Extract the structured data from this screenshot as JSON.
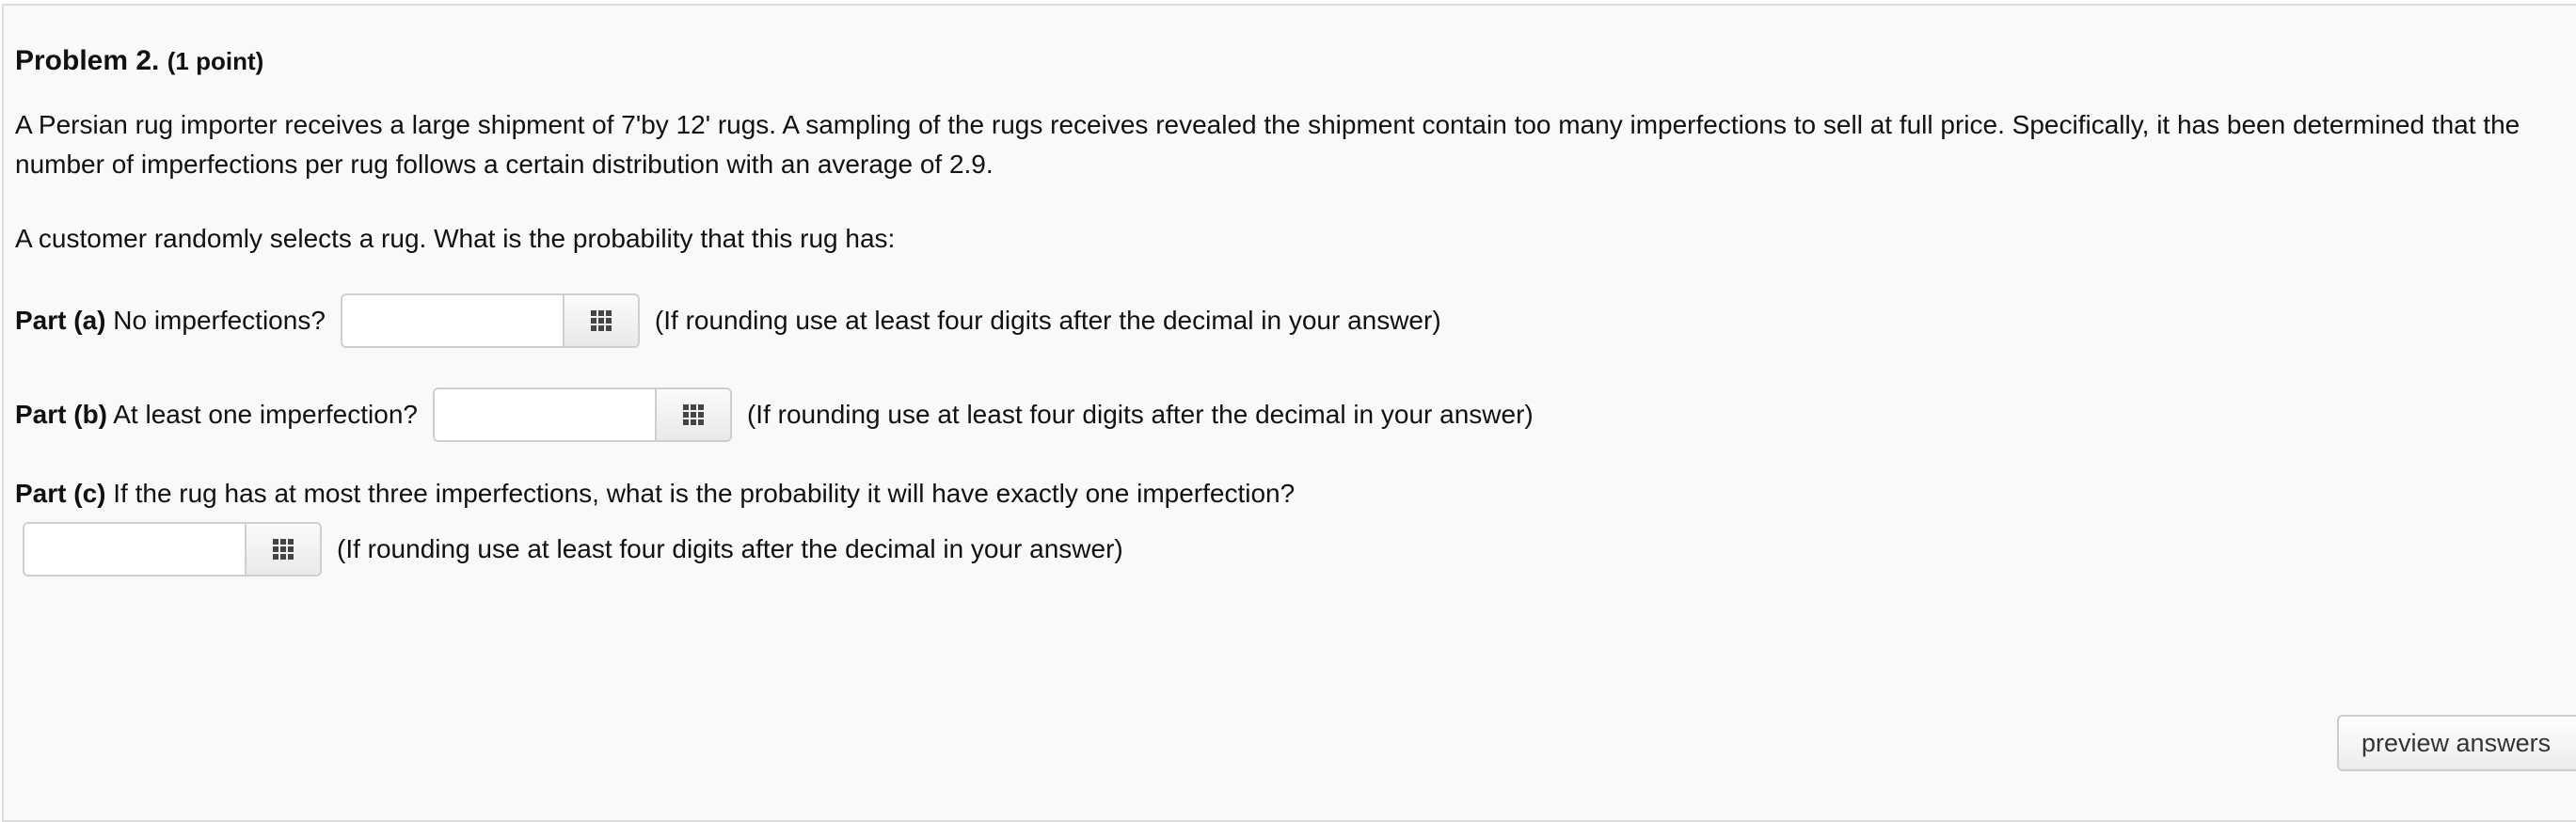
{
  "problem": {
    "title": "Problem 2.",
    "points": "(1 point)",
    "intro_line1": "A Persian rug importer receives a large shipment of 7'by 12' rugs. A sampling of the rugs receives revealed the shipment contain too many imperfections to sell at full price. Specifically, it has been determined that the",
    "intro_line2": "number of imperfections per rug follows a certain distribution with an average of 2.9.",
    "question": "A customer randomly selects a rug. What is the probability that this rug has:"
  },
  "parts": [
    {
      "label": "Part (a)",
      "text": " No imperfections?",
      "input_value": "",
      "hint": "(If rounding use at least four digits after the decimal in your answer)"
    },
    {
      "label": "Part (b)",
      "text": " At least one imperfection?",
      "input_value": "",
      "hint": "(If rounding use at least four digits after the decimal in your answer)"
    },
    {
      "label": "Part (c)",
      "text": " If the rug has at most three imperfections, what is the probability it will have exactly one imperfection?",
      "input_value": "",
      "hint": "(If rounding use at least four digits after the decimal in your answer)"
    }
  ],
  "icons": {
    "palette": "grid-icon"
  },
  "footer": {
    "preview_label": "preview answers"
  }
}
